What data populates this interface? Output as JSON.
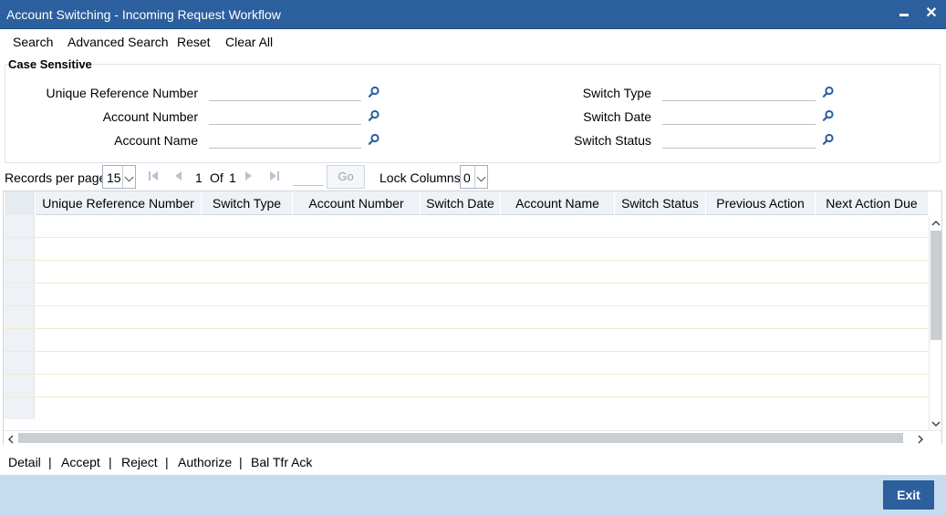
{
  "window": {
    "title": "Account Switching - Incoming Request Workflow",
    "minimize_icon": "minimize-icon",
    "close_icon": "close-icon",
    "close_glyph": "✕"
  },
  "menu": {
    "search": "Search",
    "advanced_search": "Advanced Search",
    "reset": "Reset",
    "clear_all": "Clear All"
  },
  "criteria": {
    "legend": "Case Sensitive",
    "fields": {
      "urn": {
        "label": "Unique Reference Number",
        "value": ""
      },
      "account_number": {
        "label": "Account Number",
        "value": ""
      },
      "account_name": {
        "label": "Account Name",
        "value": ""
      },
      "switch_type": {
        "label": "Switch Type",
        "value": ""
      },
      "switch_date": {
        "label": "Switch Date",
        "value": ""
      },
      "switch_status": {
        "label": "Switch Status",
        "value": ""
      }
    },
    "lookup_icon": "search-icon"
  },
  "pager": {
    "records_label": "Records per page",
    "records_value": "15",
    "current_page": "1",
    "of_label": "Of",
    "total_pages": "1",
    "go_label": "Go",
    "lock_columns_label": "Lock Columns",
    "lock_columns_value": "0"
  },
  "grid": {
    "columns": [
      "Unique Reference Number",
      "Switch Type",
      "Account Number",
      "Switch Date",
      "Account Name",
      "Switch Status",
      "Previous Action",
      "Next Action Due"
    ],
    "rows": []
  },
  "actions": {
    "detail": "Detail",
    "accept": "Accept",
    "reject": "Reject",
    "authorize": "Authorize",
    "bal_tfr_ack": "Bal Tfr Ack",
    "separator": "|"
  },
  "footer": {
    "exit": "Exit"
  },
  "colors": {
    "titlebar": "#2c5f9e",
    "footer": "#c5dcef",
    "exit_button": "#2c5f9e"
  }
}
